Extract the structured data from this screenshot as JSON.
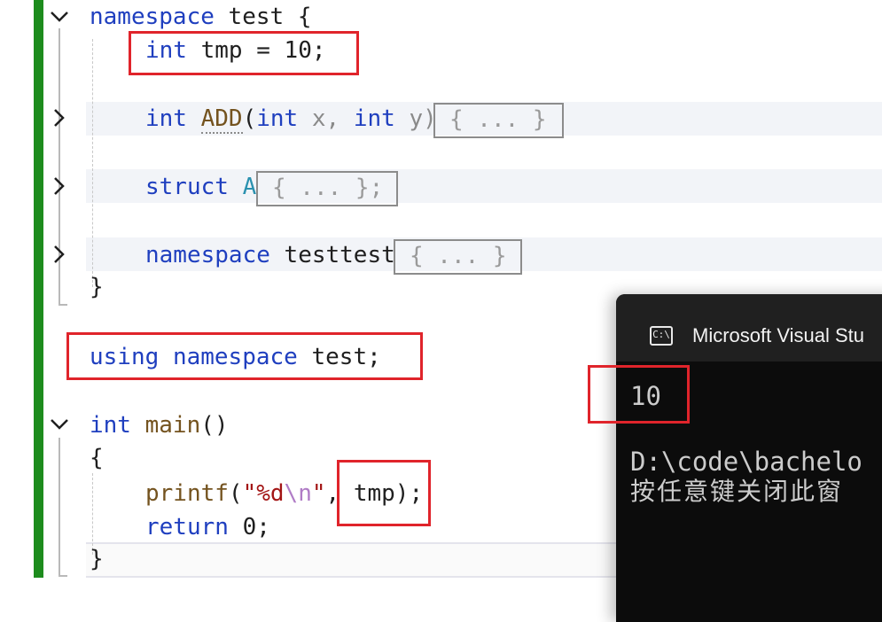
{
  "code": {
    "ns_kw": "namespace",
    "ns_name": "test",
    "brace_open": "{",
    "brace_close": "}",
    "int_kw": "int",
    "tmp_decl": " tmp = 10;",
    "add_name": "ADD",
    "add_params_open": "(",
    "int_kw2": "int",
    "param_x": " x, ",
    "int_kw3": "int",
    "param_y_close": " y)",
    "collapsed_1": "{ ... }",
    "struct_kw": "struct",
    "struct_name": "A",
    "collapsed_2": "{ ... };",
    "ns_kw2": "namespace",
    "ns_name2": " testtest",
    "collapsed_3": "{ ... }",
    "using_kw": "using",
    "using_ns_kw": "namespace",
    "using_rest": " test;",
    "main_int": "int",
    "main_name": "main",
    "main_parens": "()",
    "printf_name": "printf",
    "printf_open": "(",
    "str_part1": "\"%d",
    "str_esc": "\\n",
    "str_part2": "\"",
    "printf_comma": ", ",
    "printf_arg": "tmp",
    "printf_close": ");",
    "return_kw": "return",
    "return_val": " 0;"
  },
  "terminal": {
    "title": "Microsoft Visual Stu",
    "icon_label": "C:\\",
    "output_line1": "10",
    "output_line2": "D:\\code\\bachelo",
    "output_line3": "按任意键关闭此窗"
  },
  "colors": {
    "accent_red": "#e0242b",
    "keyword_blue": "#1f3fbf",
    "change_bar_green": "#1d8c1d",
    "terminal_bg": "#0c0c0c"
  }
}
